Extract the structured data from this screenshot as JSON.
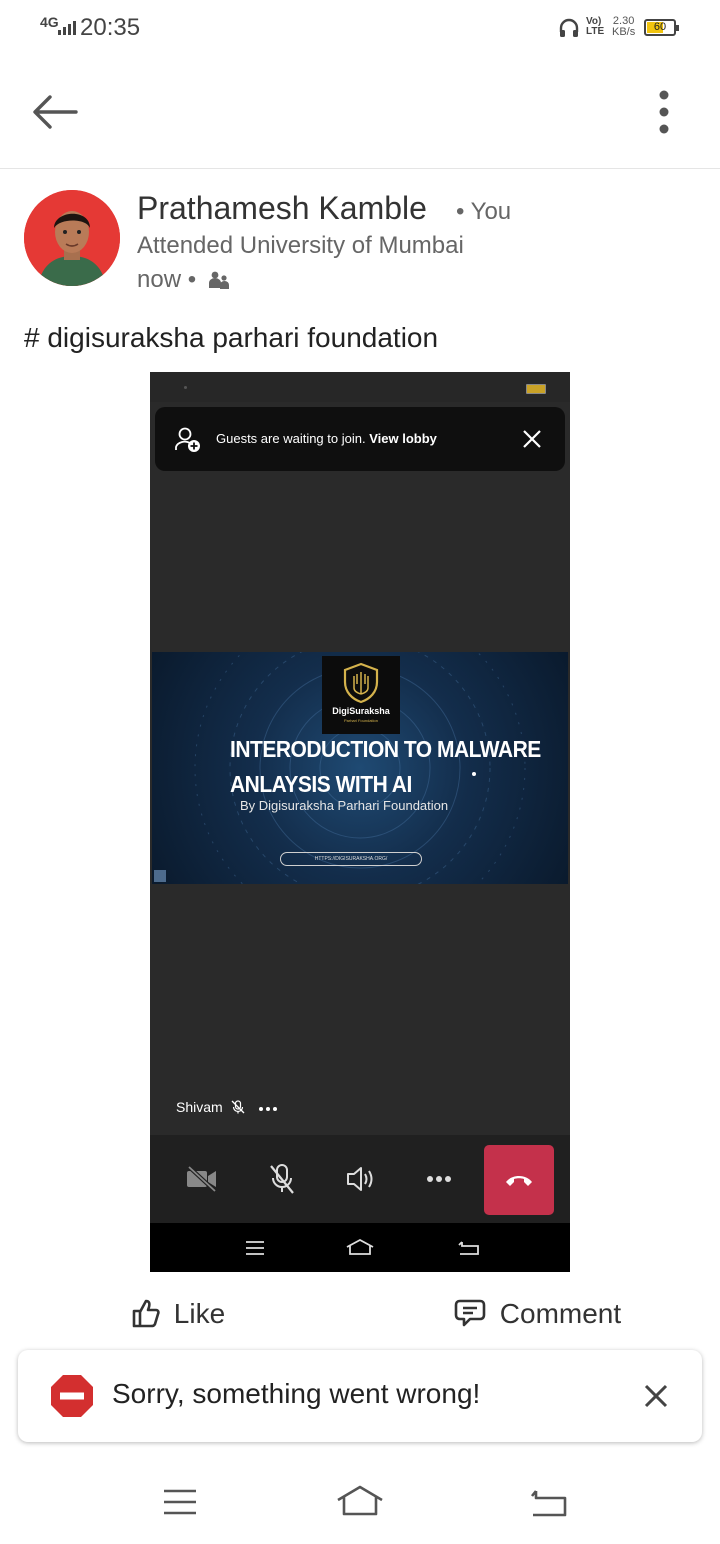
{
  "status_bar": {
    "network": "4G",
    "time": "20:35",
    "volte_top": "Vo)",
    "volte_bottom": "LTE",
    "speed_value": "2.30",
    "speed_unit": "KB/s",
    "battery": "60",
    "battery_level": 0.6
  },
  "appbar": {
    "back_icon": "arrow-left-icon",
    "menu_icon": "more-vertical-icon"
  },
  "post": {
    "author": "Prathamesh Kamble",
    "relation": "• You",
    "headline": "Attended University of Mumbai",
    "time": "now •",
    "visibility_icon": "group-icon",
    "text": "# digisuraksha parhari foundation"
  },
  "embedded": {
    "lobby_text": "Guests are waiting to join.",
    "lobby_link": "View lobby",
    "slide_brand": "DigiSuraksha",
    "slide_brand_sub": "Parhari Foundation",
    "slide_title_line1": "INTERODUCTION TO MALWARE",
    "slide_title_line2": "ANLAYSIS WITH AI",
    "slide_by": "By Digisuraksha Parhari Foundation",
    "slide_url": "HTTPS://DIGISURAKSHA.ORG/",
    "participant_name": "Shivam"
  },
  "actions": {
    "like": "Like",
    "comment": "Comment"
  },
  "toast": {
    "message": "Sorry, something went wrong!"
  }
}
